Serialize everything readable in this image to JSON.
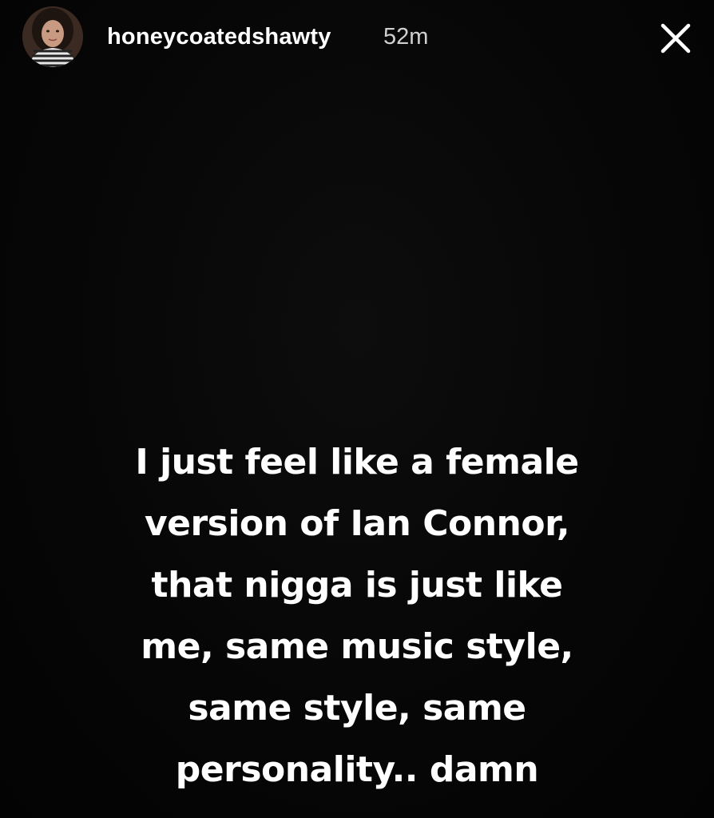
{
  "story": {
    "header": {
      "username": "honeycoatedshawty",
      "timestamp": "52m",
      "avatar_icon": "profile-photo",
      "close_icon": "close-x-icon"
    },
    "caption": {
      "lines": [
        "I just feel like a female",
        "version of Ian Connor,",
        "that nigga is just like",
        "me, same music style,",
        "same style, same",
        "personality.. damn"
      ]
    },
    "colors": {
      "background": "#000000",
      "text": "#ffffff",
      "timestamp": "#d0d0d0"
    }
  }
}
